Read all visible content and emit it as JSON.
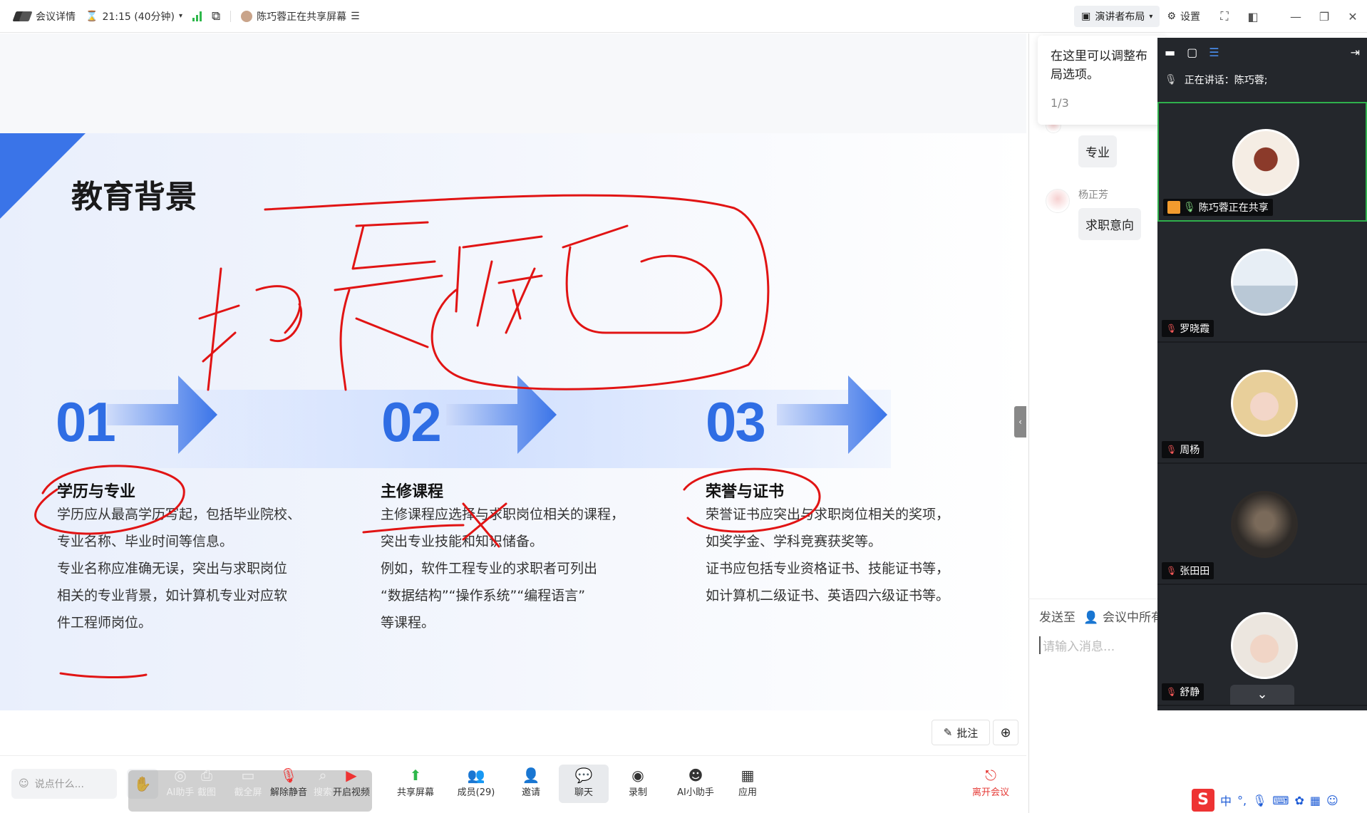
{
  "topbar": {
    "meeting_details": "会议详情",
    "timer": "21:15 (40分钟)",
    "sharing_status": "陈巧蓉正在共享屏幕",
    "layout_button": "演讲者布局",
    "settings_button": "设置"
  },
  "slide": {
    "title": "教育背景",
    "sections": [
      {
        "number": "01",
        "title": "学历与专业",
        "lines": [
          "学历应从最高学历写起，包括毕业院校、",
          "专业名称、毕业时间等信息。",
          "专业名称应准确无误，突出与求职岗位",
          "相关的专业背景，如计算机专业对应软",
          "件工程师岗位。"
        ]
      },
      {
        "number": "02",
        "title": "主修课程",
        "lines": [
          "主修课程应选择与求职岗位相关的课程，",
          "突出专业技能和知识储备。",
          "例如，软件工程专业的求职者可列出",
          "“数据结构”“操作系统”“编程语言”",
          "等课程。"
        ]
      },
      {
        "number": "03",
        "title": "荣誉与证书",
        "lines": [
          "荣誉证书应突出与求职岗位相关的奖项，",
          "如奖学金、学科竞赛获奖等。",
          "证书应包括专业资格证书、技能证书等，",
          "如计算机二级证书、英语四六级证书等。"
        ]
      }
    ],
    "annotate_button": "批注"
  },
  "toolbar": {
    "say_placeholder": "说点什么...",
    "ai_assistant_ghost": "AI助手",
    "screenshot": "截图",
    "record_fullscreen": "截全屏",
    "unmute": "解除静音",
    "search": "搜索",
    "start_video": "开启视频",
    "share_screen": "共享屏幕",
    "members": "成员(29)",
    "invite": "邀请",
    "chat": "聊天",
    "record": "录制",
    "ai_helper": "AI小助手",
    "apps": "应用",
    "leave": "离开会议"
  },
  "chat": {
    "tip_text": "在这里可以调整布局选项。",
    "tip_page": "1/3",
    "messages": [
      {
        "name": "",
        "text": "专业"
      },
      {
        "name": "杨正芳",
        "text": "求职意向"
      }
    ],
    "send_to_label": "发送至",
    "send_to_target": "会议中所有人",
    "input_placeholder": "请输入消息..."
  },
  "video": {
    "speaking_label": "正在讲话：陈巧蓉;",
    "participants": [
      {
        "name": "陈巧蓉正在共享",
        "active": true
      },
      {
        "name": "罗晓霞",
        "active": false
      },
      {
        "name": "周杨",
        "active": false
      },
      {
        "name": "张田田",
        "active": false
      },
      {
        "name": "舒静",
        "active": false
      }
    ]
  },
  "ime": {
    "lang": "中"
  },
  "colors": {
    "accent": "#2f6de4",
    "ink": "#e11414",
    "active_tile": "#2fb04c",
    "leave": "#e53935"
  }
}
